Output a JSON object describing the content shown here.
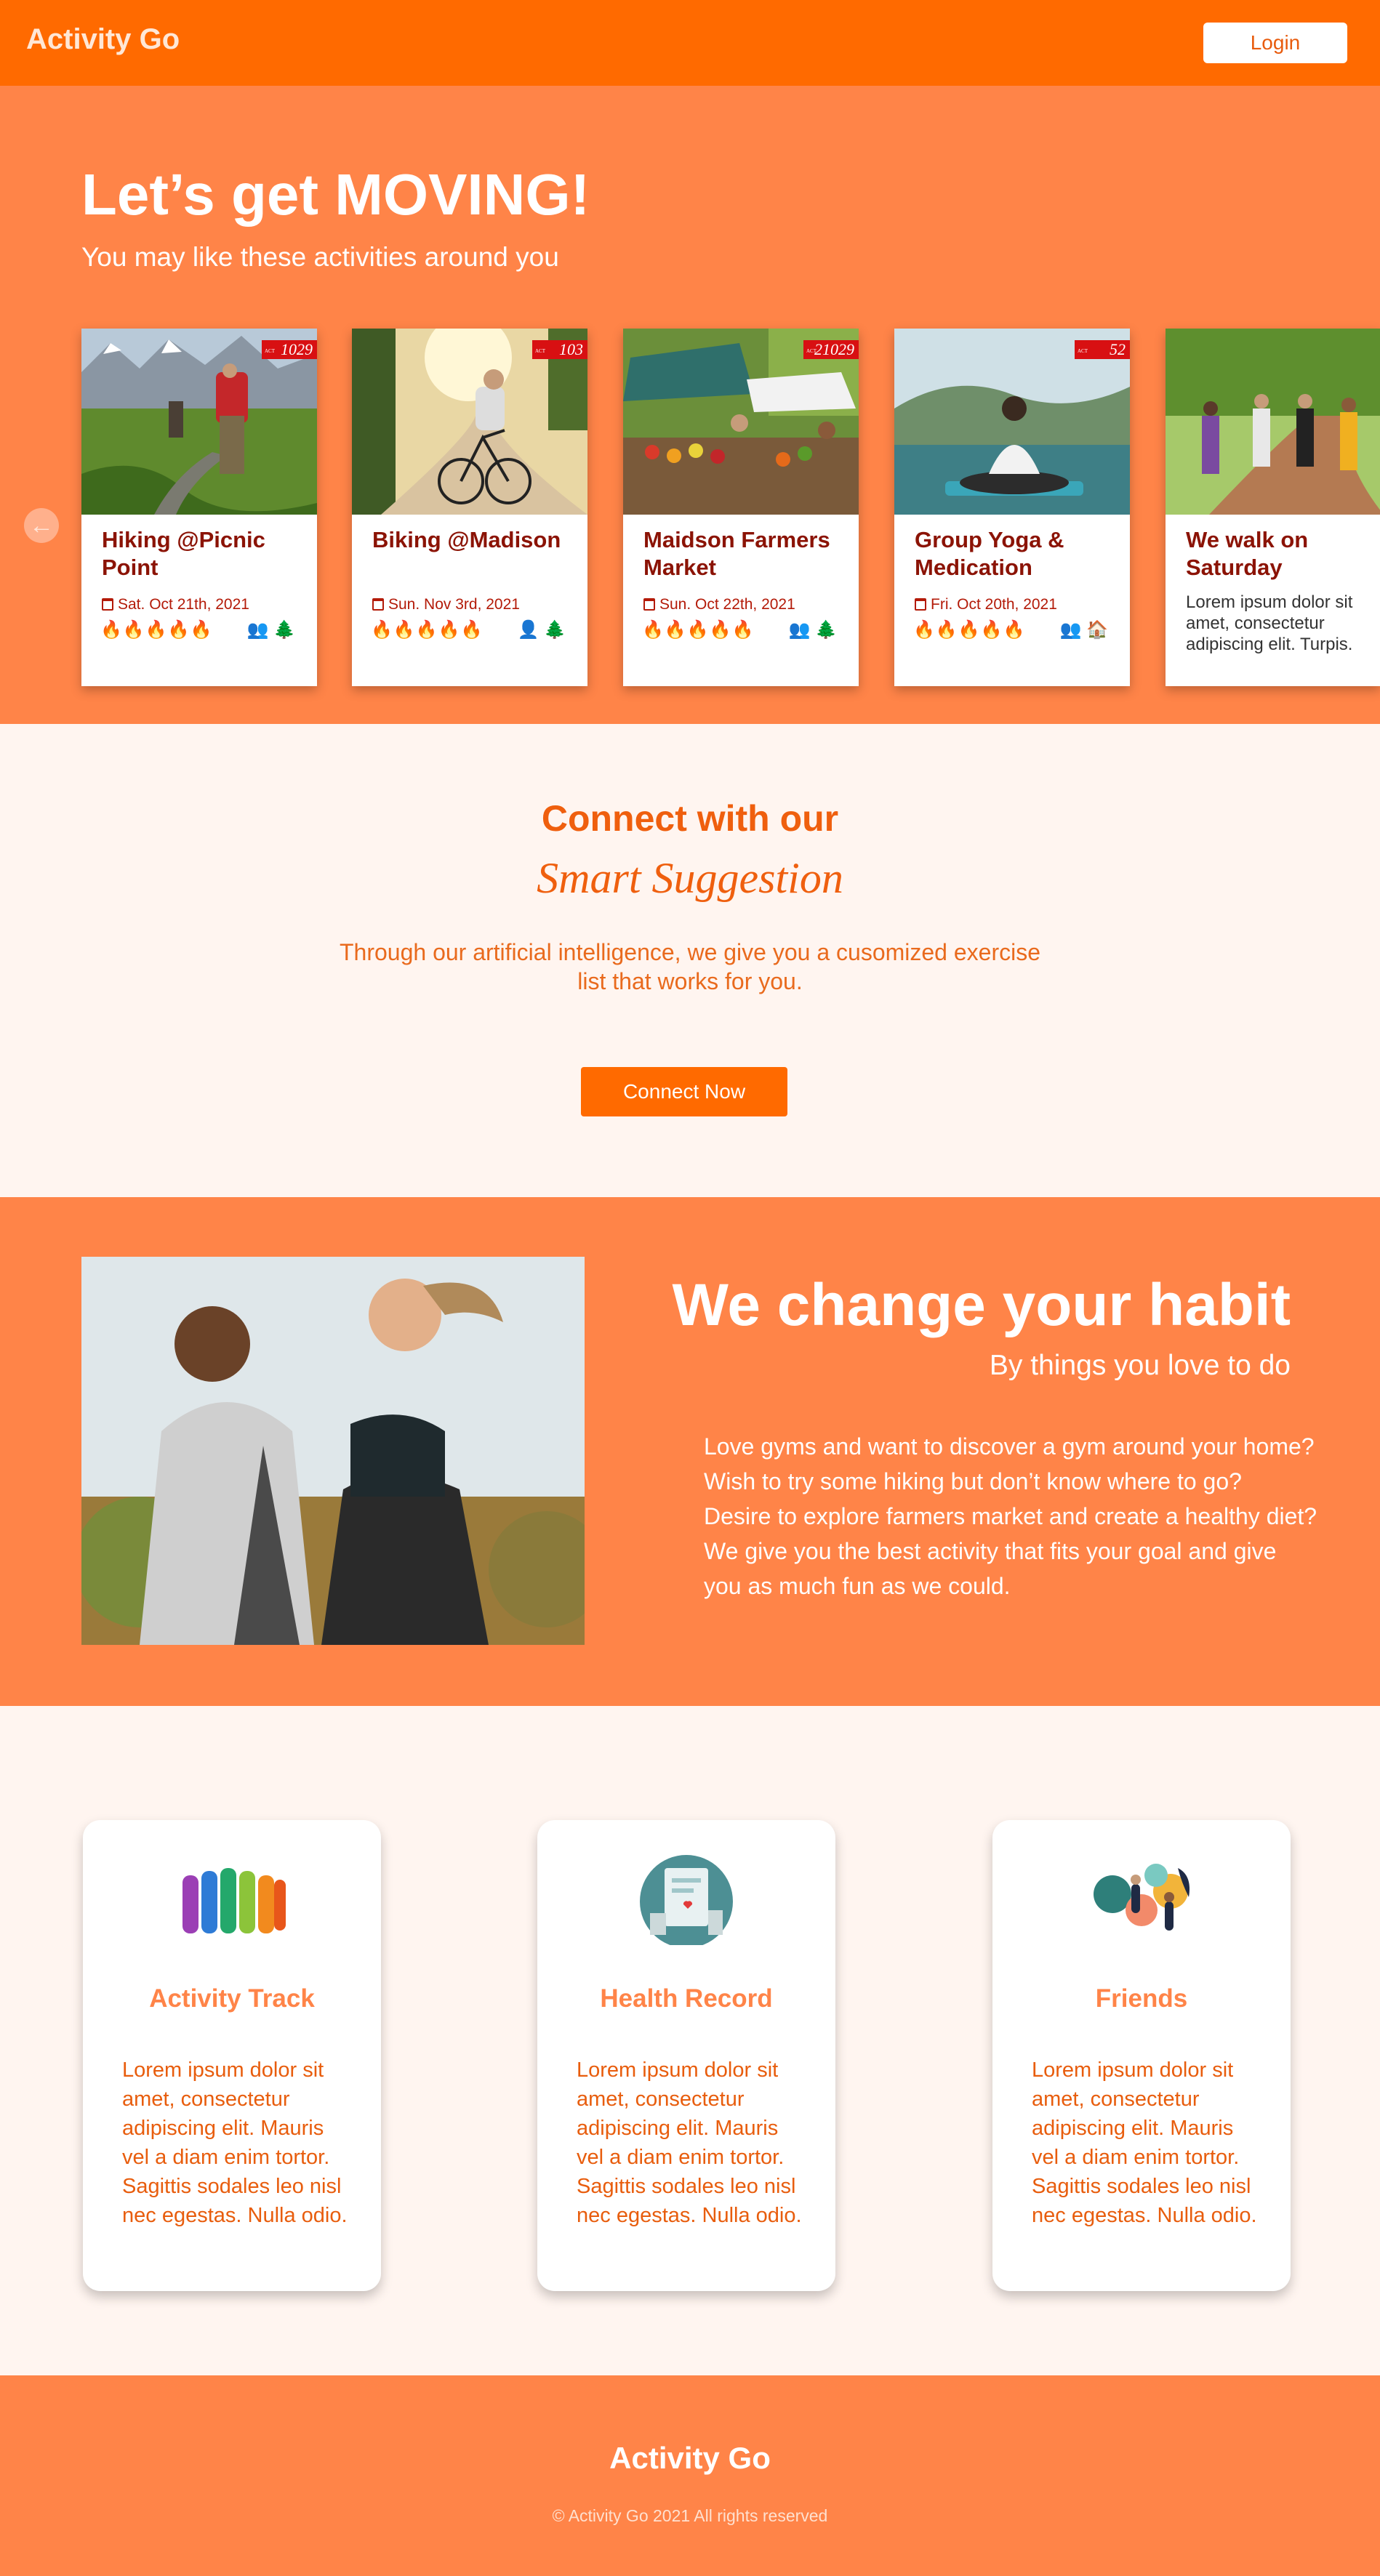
{
  "header": {
    "brand": "Activity Go",
    "login_label": "Login"
  },
  "hero": {
    "title": "Let’s get MOVING!",
    "subtitle": "You may like these activities around you",
    "prev_arrow": "←",
    "cards": [
      {
        "title": "Hiking @Picnic Point",
        "date": "Sat. Oct 21th, 2021",
        "badge": "1029",
        "flames": "hot:3,cool:2",
        "tags": "group-icon, tree-icon"
      },
      {
        "title": "Biking @Madison",
        "date": "Sun. Nov 3rd, 2021",
        "badge": "103",
        "flames": "hot:4,cool:1",
        "tags": "person-icon, tree-icon"
      },
      {
        "title": "Maidson Farmers Market",
        "date": "Sun. Oct 22th, 2021",
        "badge": "21029",
        "flames": "hot:1,cool:4",
        "tags": "group-icon, tree-icon"
      },
      {
        "title": "Group Yoga & Medication",
        "date": "Fri. Oct 20th, 2021",
        "badge": "52",
        "flames": "hot:2,cool:3",
        "tags": "pair-icon, home-icon"
      },
      {
        "title": "We walk on Saturday",
        "desc": "Lorem ipsum dolor sit amet, consectetur adipiscing elit. Turpis."
      }
    ]
  },
  "suggest": {
    "title": "Connect with our",
    "script": "Smart Suggestion",
    "text": "Through our artificial intelligence, we give you a cusomized exercise list that works for you.",
    "button": "Connect Now"
  },
  "habit": {
    "title": "We change your habit",
    "subtitle": "By things you love to do",
    "lines": [
      "Love gyms and want to discover a gym around your home?",
      "Wish to try some hiking but don’t know where to go?",
      "Desire to explore farmers market and create a healthy diet?",
      "We give you the best activity that fits your goal and give",
      "you as much fun as we could."
    ]
  },
  "features": [
    {
      "title": "Activity Track",
      "text": "Lorem ipsum dolor sit amet, consectetur adipiscing elit. Mauris vel a diam enim tortor. Sagittis sodales leo nisl nec egestas. Nulla odio."
    },
    {
      "title": "Health Record",
      "text": "Lorem ipsum dolor sit amet, consectetur adipiscing elit. Mauris vel a diam enim tortor. Sagittis sodales leo nisl nec egestas. Nulla odio."
    },
    {
      "title": "Friends",
      "text": "Lorem ipsum dolor sit amet, consectetur adipiscing elit. Mauris vel a diam enim tortor. Sagittis sodales leo nisl nec egestas. Nulla odio."
    }
  ],
  "footer": {
    "brand": "Activity Go",
    "copyright": "© Activity Go 2021 All rights reserved"
  }
}
